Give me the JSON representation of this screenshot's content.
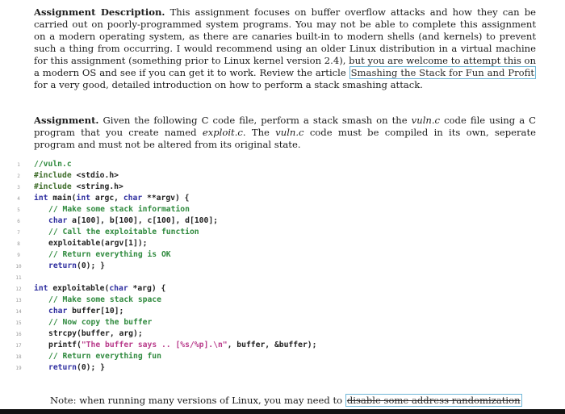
{
  "description": {
    "heading": "Assignment Description.",
    "text_a": " This assignment focuses on buffer overflow attacks and how they can be carried out on poorly-programmed system programs. You may not be able to complete this assignment on a modern operating system, as there are canaries built-in to modern shells (and kernels) to prevent such a thing from occurring. I would recommend using an older Linux distribution in a virtual machine for this assignment (something prior to Linux kernel version 2.4), but you are welcome to attempt this on a modern OS and see if you can get it to work. Review the article ",
    "link": "Smashing the Stack for Fun and Profit",
    "text_b": " for a very good, detailed introduction on how to perform a stack smashing attack."
  },
  "assignment": {
    "heading": "Assignment.",
    "text_a": " Given the following C code file, perform a stack smash on the ",
    "file1": "vuln.c",
    "text_b": " code file using a C program that you create named ",
    "file2": "exploit.c",
    "text_c": ". The ",
    "file3": "vuln.c",
    "text_d": " code must be compiled in its own, seperate program and must not be altered from its original state."
  },
  "code": {
    "line_numbers": [
      "1",
      "2",
      "3",
      "4",
      "5",
      "6",
      "7",
      "8",
      "9",
      "10",
      "11",
      "12",
      "13",
      "14",
      "15",
      "16",
      "17",
      "18",
      "19"
    ],
    "l1": "//vuln.c",
    "l2_pp": "#include",
    "l2_rest": " <stdio.h>",
    "l3_pp": "#include",
    "l3_rest": " <string.h>",
    "l4_kw1": "int",
    "l4_a": " main(",
    "l4_kw2": "int",
    "l4_b": " argc, ",
    "l4_kw3": "char",
    "l4_c": " **argv) {",
    "l5": "// Make some stack information",
    "l6_kw": "char",
    "l6_rest": " a[100], b[100], c[100], d[100];",
    "l7": "// Call the exploitable function",
    "l8": "exploitable(argv[1]);",
    "l9": "// Return everything is OK",
    "l10_kw": "return",
    "l10_rest": "(0); }",
    "l12_kw1": "int",
    "l12_a": " exploitable(",
    "l12_kw2": "char",
    "l12_b": " *arg) {",
    "l13": "// Make some stack space",
    "l14_kw": "char",
    "l14_rest": " buffer[10];",
    "l15": "// Now copy the buffer",
    "l16": "strcpy(buffer, arg);",
    "l17_a": "printf(",
    "l17_str": "\"The buffer says .. [%s/%p].\\n\"",
    "l17_b": ", buffer, &buffer);",
    "l18": "// Return everything fun",
    "l19_kw": "return",
    "l19_rest": "(0); }"
  },
  "note": {
    "text": "Note: when running many versions of Linux, you may need to ",
    "link": "disable some address randomization"
  }
}
